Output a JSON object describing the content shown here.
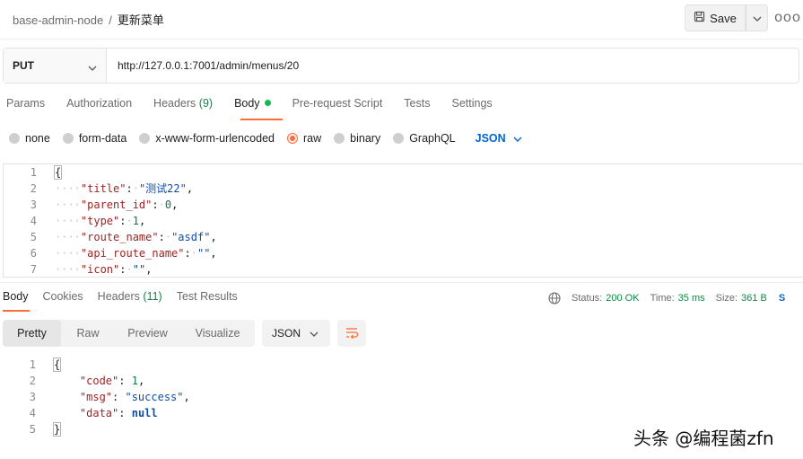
{
  "breadcrumb": {
    "collection": "base-admin-node",
    "separator": "/",
    "current": "更新菜单"
  },
  "toolbar": {
    "save_label": "Save",
    "more_label": "ooo"
  },
  "request": {
    "method": "PUT",
    "url": "http://127.0.0.1:7001/admin/menus/20"
  },
  "request_tabs": [
    {
      "label": "Params"
    },
    {
      "label": "Authorization"
    },
    {
      "label": "Headers",
      "count": "(9)"
    },
    {
      "label": "Body",
      "active": true
    },
    {
      "label": "Pre-request Script"
    },
    {
      "label": "Tests"
    },
    {
      "label": "Settings"
    }
  ],
  "body_types": {
    "options": [
      "none",
      "form-data",
      "x-www-form-urlencoded",
      "raw",
      "binary",
      "GraphQL"
    ],
    "selected": "raw",
    "format": "JSON"
  },
  "request_body_lines": [
    {
      "num": "1",
      "key": "",
      "value": ""
    },
    {
      "num": "2",
      "key": "\"title\"",
      "value": "\"测试22\""
    },
    {
      "num": "3",
      "key": "\"parent_id\"",
      "value": "0"
    },
    {
      "num": "4",
      "key": "\"type\"",
      "value": "1"
    },
    {
      "num": "5",
      "key": "\"route_name\"",
      "value": "\"asdf\""
    },
    {
      "num": "6",
      "key": "\"api_route_name\"",
      "value": "\"\""
    },
    {
      "num": "7",
      "key": "\"icon\"",
      "value": "\"\""
    }
  ],
  "response_tabs": [
    {
      "label": "Body",
      "active": true
    },
    {
      "label": "Cookies"
    },
    {
      "label": "Headers",
      "count": "(11)"
    },
    {
      "label": "Test Results"
    }
  ],
  "status": {
    "status_label": "Status:",
    "status_value": "200 OK",
    "time_label": "Time:",
    "time_value": "35 ms",
    "size_label": "Size:",
    "size_value": "361 B",
    "trailing": "S"
  },
  "response_views": [
    "Pretty",
    "Raw",
    "Preview",
    "Visualize"
  ],
  "response_view_selected": "Pretty",
  "response_format": "JSON",
  "response_body_lines": [
    {
      "num": "1",
      "key": "",
      "value": ""
    },
    {
      "num": "2",
      "key": "\"code\"",
      "value": "1"
    },
    {
      "num": "3",
      "key": "\"msg\"",
      "value": "\"success\""
    },
    {
      "num": "4",
      "key": "\"data\"",
      "value": "null"
    },
    {
      "num": "5",
      "key": "",
      "value": ""
    }
  ],
  "watermark": "头条 @编程菌zfn",
  "colors": {
    "accent": "#ff6c37",
    "link": "#0265d2",
    "success": "#0b8a43"
  }
}
